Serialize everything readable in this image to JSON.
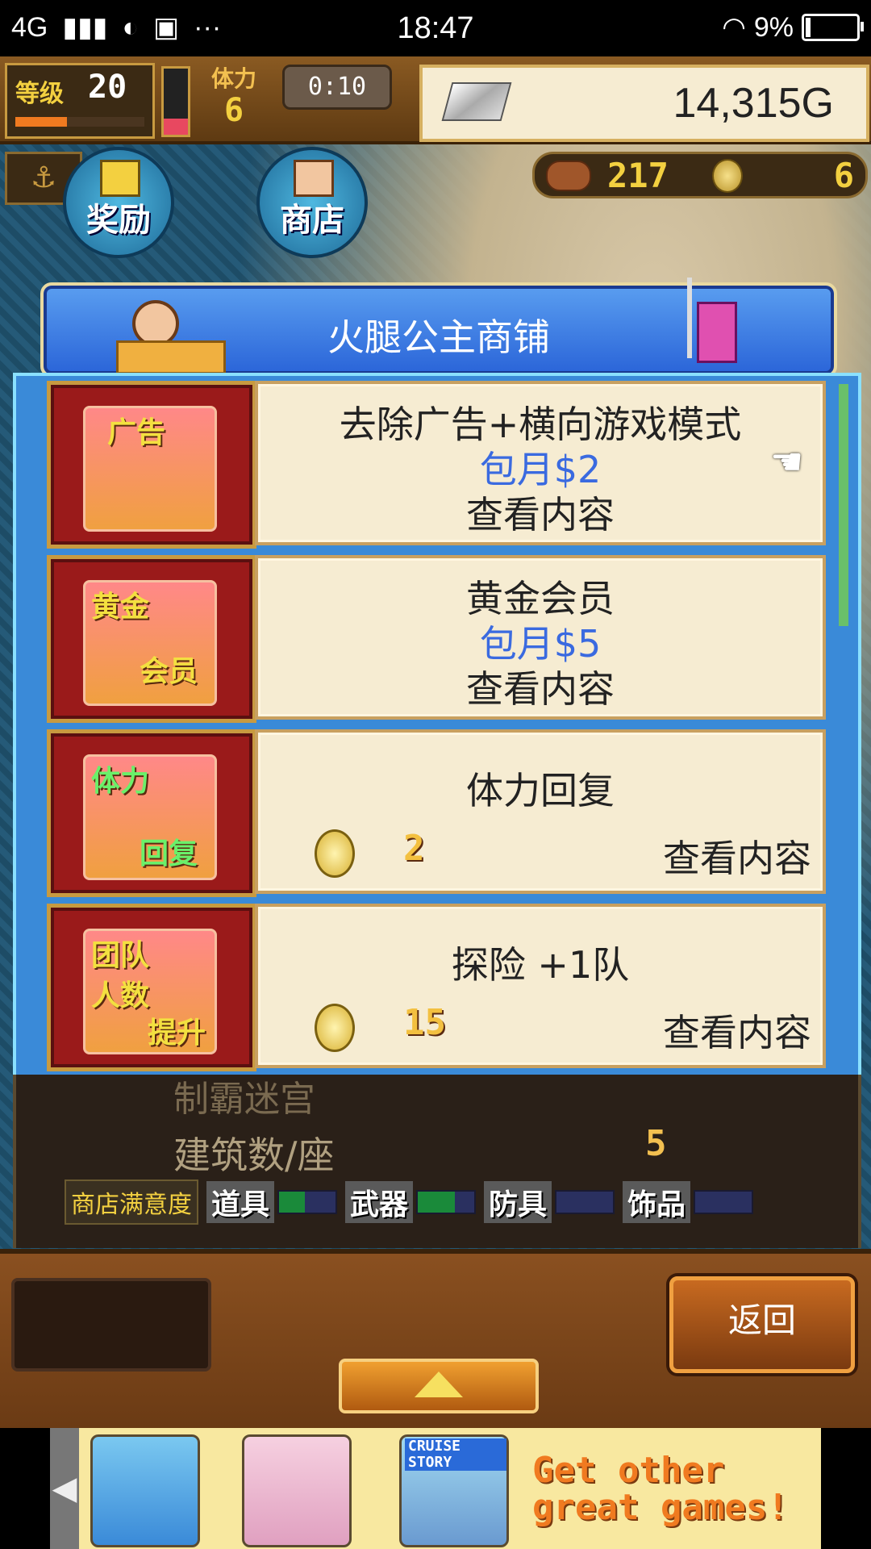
{
  "status_bar": {
    "network": "4G",
    "time": "18:47",
    "battery": "9%",
    "battery_level": 0.09
  },
  "hud": {
    "level_label": "等级",
    "level_value": "20",
    "level_progress": 0.4,
    "stamina_label": "体力",
    "stamina_value": "6",
    "stamina_fill": 0.25,
    "timer": "0:10",
    "gold": "14,315G",
    "food": "217",
    "medals": "6",
    "reward_label": "奖励",
    "shop_label": "商店"
  },
  "shop": {
    "title": "火腿公主商铺",
    "items": [
      {
        "icon_label_1": "广告",
        "name": "去除广告+横向游戏模式",
        "price": "包月$2",
        "view": "查看内容"
      },
      {
        "icon_label_1": "黄金",
        "icon_label_2": "会员",
        "name": "黄金会员",
        "price": "包月$5",
        "view": "查看内容"
      },
      {
        "icon_label_1": "体力",
        "icon_label_2": "回复",
        "name": "体力回复",
        "coins": "2",
        "view": "查看内容"
      },
      {
        "icon_label_1": "团队",
        "icon_label_2": "人数",
        "icon_label_3": "提升",
        "name": "探险 +1队",
        "coins": "15",
        "view": "查看内容"
      }
    ]
  },
  "stats": {
    "partial_label": "制霸迷宫",
    "buildings_label": "建筑数/座",
    "buildings_value": "5",
    "satisfaction_title": "商店满意度",
    "satisfaction": [
      {
        "name": "道具",
        "level": 0.45
      },
      {
        "name": "武器",
        "level": 0.65
      },
      {
        "name": "防具",
        "level": 0.0
      },
      {
        "name": "饰品",
        "level": 0.0
      }
    ]
  },
  "bottom": {
    "back_label": "返回"
  },
  "ad": {
    "game3_title": "CRUISE STORY",
    "text_line1": "Get other",
    "text_line2": "great games!"
  }
}
